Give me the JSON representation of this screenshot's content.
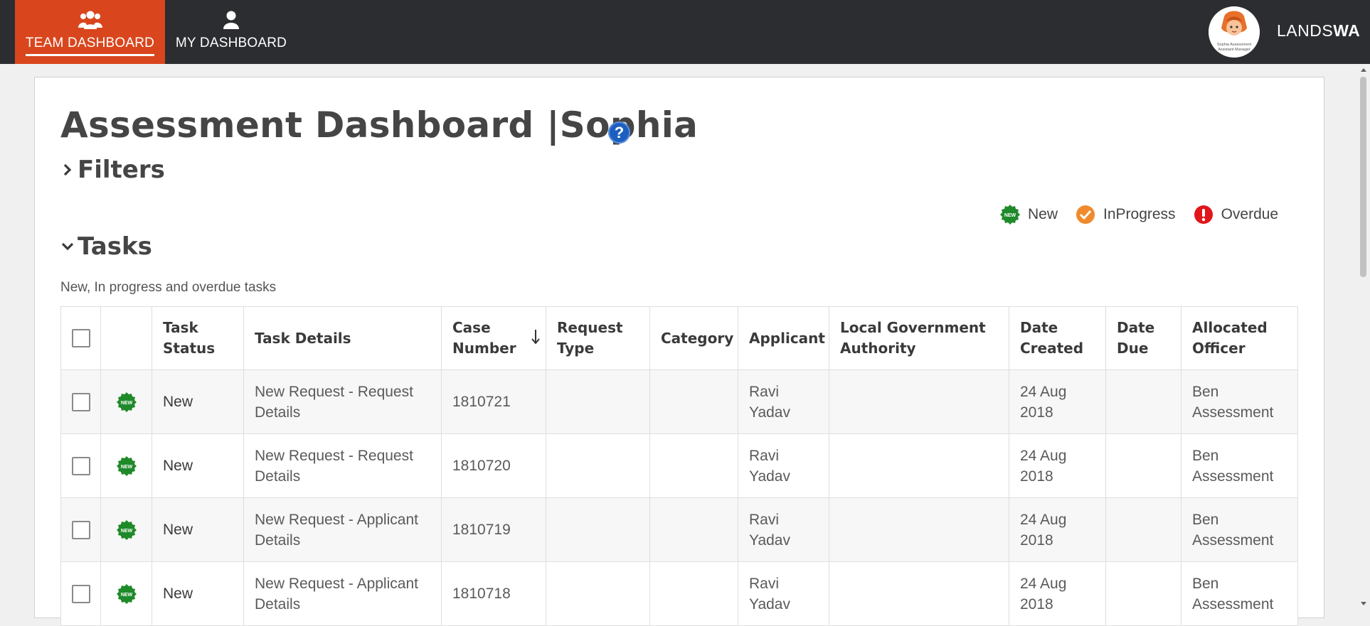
{
  "nav": {
    "tabs": [
      {
        "label": "TEAM DASHBOARD",
        "icon": "team-icon",
        "active": true
      },
      {
        "label": "MY DASHBOARD",
        "icon": "user-icon",
        "active": false
      }
    ],
    "brand_light": "LANDS",
    "brand_bold": "WA",
    "avatar_caption": "Sophia Assessment Assistant Manager"
  },
  "page": {
    "title": "Assessment Dashboard |Sophia",
    "help_symbol": "?"
  },
  "filters": {
    "label": "Filters"
  },
  "legend": [
    {
      "label": "New",
      "icon": "new-badge-icon",
      "color": "#1f8a2a"
    },
    {
      "label": "InProgress",
      "icon": "inprogress-check-icon",
      "color": "#f08a2c"
    },
    {
      "label": "Overdue",
      "icon": "overdue-alert-icon",
      "color": "#e0161b"
    }
  ],
  "tasks": {
    "label": "Tasks",
    "subtitle": "New, In progress and overdue tasks",
    "columns": [
      "",
      "",
      "Task Status",
      "Task Details",
      "Case Number",
      "Request Type",
      "Category",
      "Applicant",
      "Local Government Authority",
      "Date Created",
      "Date Due",
      "Allocated Officer"
    ],
    "sort_column": "Case Number",
    "rows": [
      {
        "status": "New",
        "details": "New Request - Request Details",
        "case_number": "1810721",
        "request_type": "",
        "category": "",
        "applicant": "Ravi Yadav",
        "lga": "",
        "date_created": "24 Aug 2018",
        "date_due": "",
        "officer": "Ben Assessment"
      },
      {
        "status": "New",
        "details": "New Request - Request Details",
        "case_number": "1810720",
        "request_type": "",
        "category": "",
        "applicant": "Ravi Yadav",
        "lga": "",
        "date_created": "24 Aug 2018",
        "date_due": "",
        "officer": "Ben Assessment"
      },
      {
        "status": "New",
        "details": "New Request - Applicant Details",
        "case_number": "1810719",
        "request_type": "",
        "category": "",
        "applicant": "Ravi Yadav",
        "lga": "",
        "date_created": "24 Aug 2018",
        "date_due": "",
        "officer": "Ben Assessment"
      },
      {
        "status": "New",
        "details": "New Request - Applicant Details",
        "case_number": "1810718",
        "request_type": "",
        "category": "",
        "applicant": "Ravi Yadav",
        "lga": "",
        "date_created": "24 Aug 2018",
        "date_due": "",
        "officer": "Ben Assessment"
      }
    ]
  },
  "badge_text": "NEW",
  "colors": {
    "nav_bg": "#2b2d31",
    "active_tab": "#d9461d",
    "help": "#1d5fbf",
    "new_green": "#1f8a2a"
  }
}
